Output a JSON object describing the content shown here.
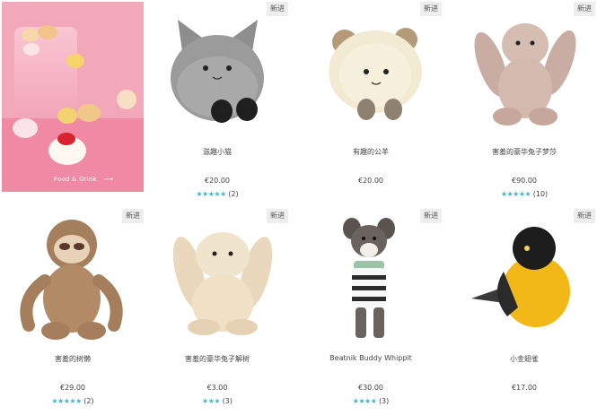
{
  "promo": {
    "link_label": "Food & Drink",
    "arrow": "⟶"
  },
  "badge_label": "新进",
  "products": [
    {
      "name": "滋趣小猫",
      "price": "€20.00",
      "stars": "★★★★★",
      "review_count": "(2)"
    },
    {
      "name": "有趣的公羊",
      "price": "€20.00",
      "stars": "",
      "review_count": ""
    },
    {
      "name": "害羞的豪华兔子梦莎",
      "price": "€90.00",
      "stars": "★★★★★",
      "review_count": "(10)"
    },
    {
      "name": "害羞的树懒",
      "price": "€29.00",
      "stars": "★★★★★",
      "review_count": "(2)"
    },
    {
      "name": "害羞的豪华兔子解树",
      "price": "€3.00",
      "stars": "★★★",
      "review_count": "(3)"
    },
    {
      "name": "Beatnik Buddy Whippit",
      "price": "€30.00",
      "stars": "★★★★",
      "review_count": "(3)"
    },
    {
      "name": "小金翅雀",
      "price": "€17.00",
      "stars": "",
      "review_count": ""
    }
  ],
  "colors": {
    "promo_bg": "#f3a7bb",
    "star": "#3fb8c3",
    "badge_bg": "#eeeeee"
  }
}
